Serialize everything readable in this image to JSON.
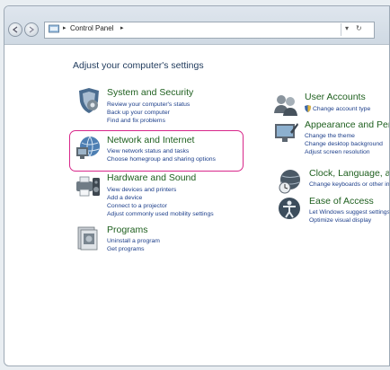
{
  "address_bar": {
    "crumbs": [
      "Control Panel"
    ],
    "refresh_glyph": "↻",
    "dropdown_glyph": "▾"
  },
  "main": {
    "heading": "Adjust your computer's settings",
    "left_categories": [
      {
        "title": "System and Security",
        "icon": "shield-gear-icon",
        "links": [
          "Review your computer's status",
          "Back up your computer",
          "Find and fix problems"
        ]
      },
      {
        "title": "Network and Internet",
        "icon": "network-globe-icon",
        "links": [
          "View network status and tasks",
          "Choose homegroup and sharing options"
        ]
      },
      {
        "title": "Hardware and Sound",
        "icon": "printer-speaker-icon",
        "links": [
          "View devices and printers",
          "Add a device",
          "Connect to a projector",
          "Adjust commonly used mobility settings"
        ]
      },
      {
        "title": "Programs",
        "icon": "programs-icon",
        "links": [
          "Uninstall a program",
          "Get programs"
        ]
      }
    ],
    "right_categories": [
      {
        "title": "User Accounts",
        "icon": "users-icon",
        "links": [
          "Change account type"
        ]
      },
      {
        "title": "Appearance and Perso",
        "icon": "appearance-icon",
        "links": [
          "Change the theme",
          "Change desktop background",
          "Adjust screen resolution"
        ]
      },
      {
        "title": "Clock, Language, and R",
        "icon": "clock-globe-icon",
        "links": [
          "Change keyboards or other in"
        ]
      },
      {
        "title": "Ease of Access",
        "icon": "ease-of-access-icon",
        "links": [
          "Let Windows suggest settings",
          "Optimize visual display"
        ]
      }
    ]
  },
  "colors": {
    "highlight": "#d8278a",
    "link": "#1c3e8a",
    "category_title": "#1e5f1e"
  }
}
